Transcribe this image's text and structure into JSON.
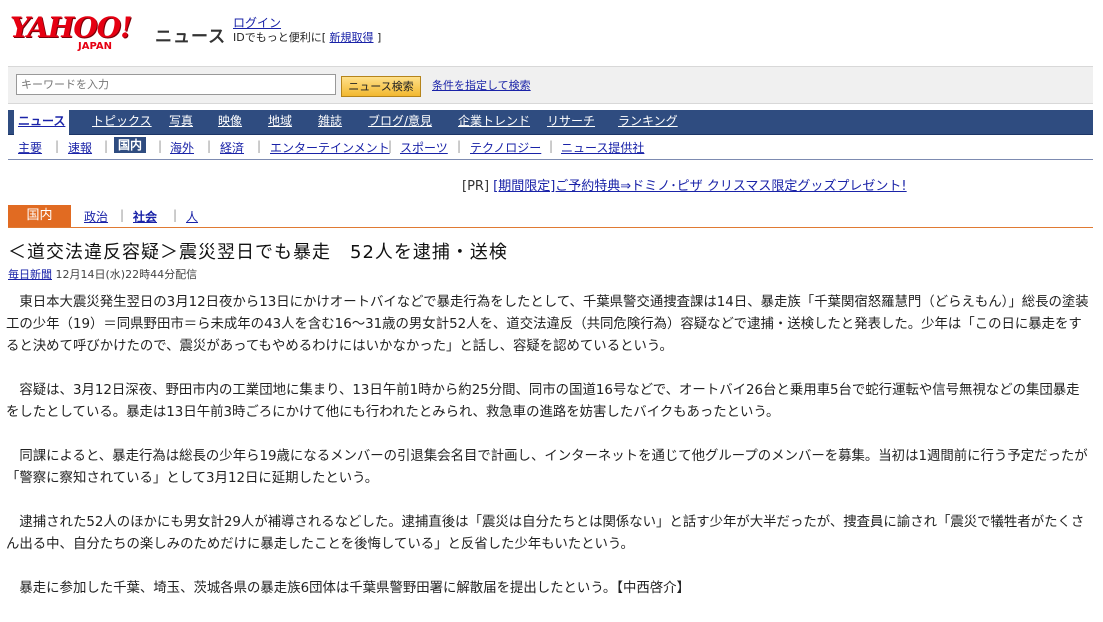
{
  "header": {
    "logo_main": "YAHOO!",
    "logo_sub": "JAPAN",
    "service": "ニュース",
    "login": "ログイン",
    "login_sub_prefix": "IDでもっと便利に[",
    "register": "新規取得",
    "login_sub_suffix": "]"
  },
  "search": {
    "placeholder": "キーワードを入力",
    "button": "ニュース検索",
    "advanced": "条件を指定して検索"
  },
  "main_nav": [
    "ニュース",
    "トピックス",
    "写真",
    "映像",
    "地域",
    "雑誌",
    "ブログ/意見",
    "企業トレンド",
    "リサーチ",
    "ランキング"
  ],
  "sub_nav": [
    "主要",
    "速報",
    "国内",
    "海外",
    "経済",
    "エンターテインメント",
    "スポーツ",
    "テクノロジー",
    "ニュース提供社"
  ],
  "sub_nav_active": "国内",
  "pr": {
    "tag": "[PR]",
    "text": "[期間限定]ご予約特典⇒ドミノ･ピザ クリスマス限定グッズプレゼント!"
  },
  "category": {
    "title": "国内",
    "links": [
      "政治",
      "社会",
      "人"
    ],
    "active": "社会"
  },
  "article": {
    "title": "＜道交法違反容疑＞震災翌日でも暴走　52人を逮捕・送検",
    "source": "毎日新聞",
    "date": "12月14日(水)22時44分配信",
    "paragraphs": [
      "東日本大震災発生翌日の3月12日夜から13日にかけオートバイなどで暴走行為をしたとして、千葉県警交通捜査課は14日、暴走族「千葉関宿怒羅慧門（どらえもん）」総長の塗装工の少年（19）＝同県野田市＝ら未成年の43人を含む16～31歳の男女計52人を、道交法違反（共同危険行為）容疑などで逮捕・送検したと発表した。少年は「この日に暴走をすると決めて呼びかけたので、震災があってもやめるわけにはいかなかった」と話し、容疑を認めているという。",
      "容疑は、3月12日深夜、野田市内の工業団地に集まり、13日午前1時から約25分間、同市の国道16号などで、オートバイ26台と乗用車5台で蛇行運転や信号無視などの集団暴走をしたとしている。暴走は13日午前3時ごろにかけて他にも行われたとみられ、救急車の進路を妨害したバイクもあったという。",
      "同課によると、暴走行為は総長の少年ら19歳になるメンバーの引退集会名目で計画し、インターネットを通じて他グループのメンバーを募集。当初は1週間前に行う予定だったが「警察に察知されている」として3月12日に延期したという。",
      "逮捕された52人のほかにも男女計29人が補導されるなどした。逮捕直後は「震災は自分たちとは関係ない」と話す少年が大半だったが、捜査員に諭され「震災で犠牲者がたくさん出る中、自分たちの楽しみのためだけに暴走したことを後悔している」と反省した少年もいたという。",
      "暴走に参加した千葉、埼玉、茨城各県の暴走族6団体は千葉県警野田署に解散届を提出したという。【中西啓介】"
    ]
  }
}
